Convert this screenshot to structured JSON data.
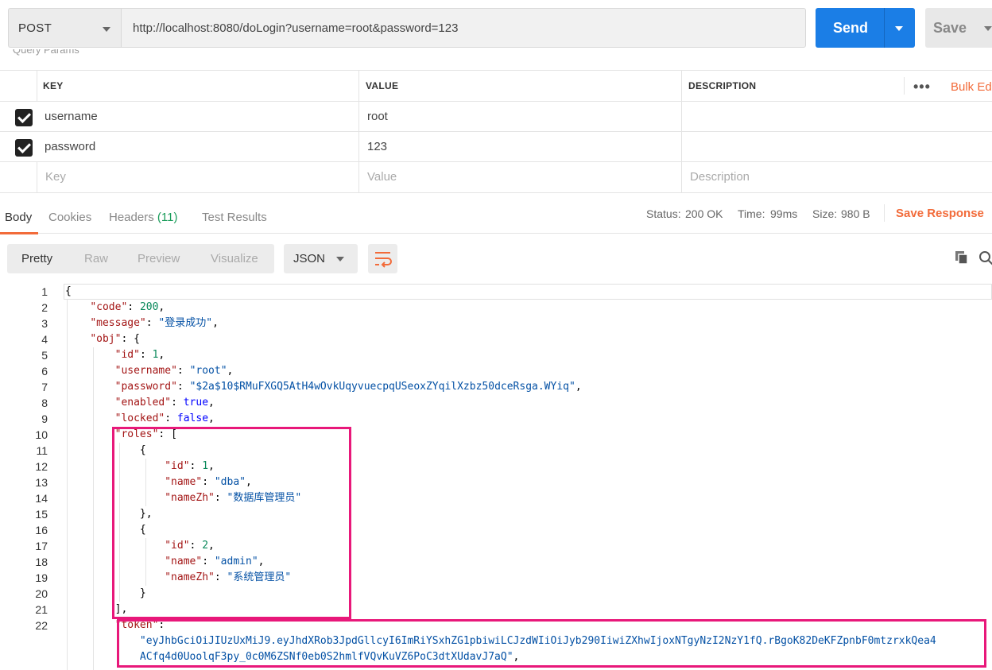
{
  "request": {
    "method": "POST",
    "url": "http://localhost:8080/doLogin?username=root&password=123",
    "send_label": "Send",
    "save_label": "Save",
    "section_cutoff": "Query Params"
  },
  "params": {
    "headers": [
      "KEY",
      "VALUE",
      "DESCRIPTION"
    ],
    "bulk_edit": "Bulk Edit",
    "rows": [
      {
        "key": "username",
        "value": "root"
      },
      {
        "key": "password",
        "value": "123"
      }
    ],
    "placeholders": {
      "key": "Key",
      "value": "Value",
      "description": "Description"
    }
  },
  "response_tabs": {
    "body": "Body",
    "cookies": "Cookies",
    "headers": "Headers",
    "headers_count": "(11)",
    "tests": "Test Results"
  },
  "status": {
    "status_label": "Status:",
    "status_value": "200 OK",
    "time_label": "Time:",
    "time_value": "99ms",
    "size_label": "Size:",
    "size_value": "980 B",
    "save_response": "Save Response"
  },
  "view_tabs": [
    "Pretty",
    "Raw",
    "Preview",
    "Visualize"
  ],
  "format": "JSON",
  "code_lines": [
    {
      "n": "1"
    },
    {
      "n": "2"
    },
    {
      "n": "3"
    },
    {
      "n": "4"
    },
    {
      "n": "5"
    },
    {
      "n": "6"
    },
    {
      "n": "7"
    },
    {
      "n": "8"
    },
    {
      "n": "9"
    },
    {
      "n": "10"
    },
    {
      "n": "11"
    },
    {
      "n": "12"
    },
    {
      "n": "13"
    },
    {
      "n": "14"
    },
    {
      "n": "15"
    },
    {
      "n": "16"
    },
    {
      "n": "17"
    },
    {
      "n": "18"
    },
    {
      "n": "19"
    },
    {
      "n": "20"
    },
    {
      "n": "21"
    },
    {
      "n": "22"
    }
  ],
  "json": {
    "code_key": "\"code\"",
    "code_val": "200",
    "message_key": "\"message\"",
    "message_val": "\"登录成功\"",
    "obj_key": "\"obj\"",
    "id_key": "\"id\"",
    "id_val": "1",
    "username_key": "\"username\"",
    "username_val": "\"root\"",
    "password_key": "\"password\"",
    "password_val": "\"$2a$10$RMuFXGQ5AtH4wOvkUqyvuecpqUSeoxZYqilXzbz50dceRsga.WYiq\"",
    "enabled_key": "\"enabled\"",
    "enabled_val": "true",
    "locked_key": "\"locked\"",
    "locked_val": "false",
    "roles_key": "\"roles\"",
    "r1_id_val": "1",
    "r1_name_val": "\"dba\"",
    "r1_namezh_val": "\"数据库管理员\"",
    "r2_id_val": "2",
    "r2_name_val": "\"admin\"",
    "r2_namezh_val": "\"系统管理员\"",
    "name_key": "\"name\"",
    "namezh_key": "\"nameZh\"",
    "token_key": "\"token\"",
    "token_val_1": "\"eyJhbGciOiJIUzUxMiJ9.eyJhdXRob3JpdGllcyI6ImRiYSxhZG1pbiwiLCJzdWIiOiJyb290IiwiZXhwIjoxNTgyNzI2NzY1fQ.rBgoK82DeKFZpnbF0mtzrxkQea4",
    "token_val_2": "ACfq4d0UoolqF3py_0c0M6ZSNf0eb0S2hmlfVQvKuVZ6PoC3dtXUdavJ7aQ\""
  }
}
